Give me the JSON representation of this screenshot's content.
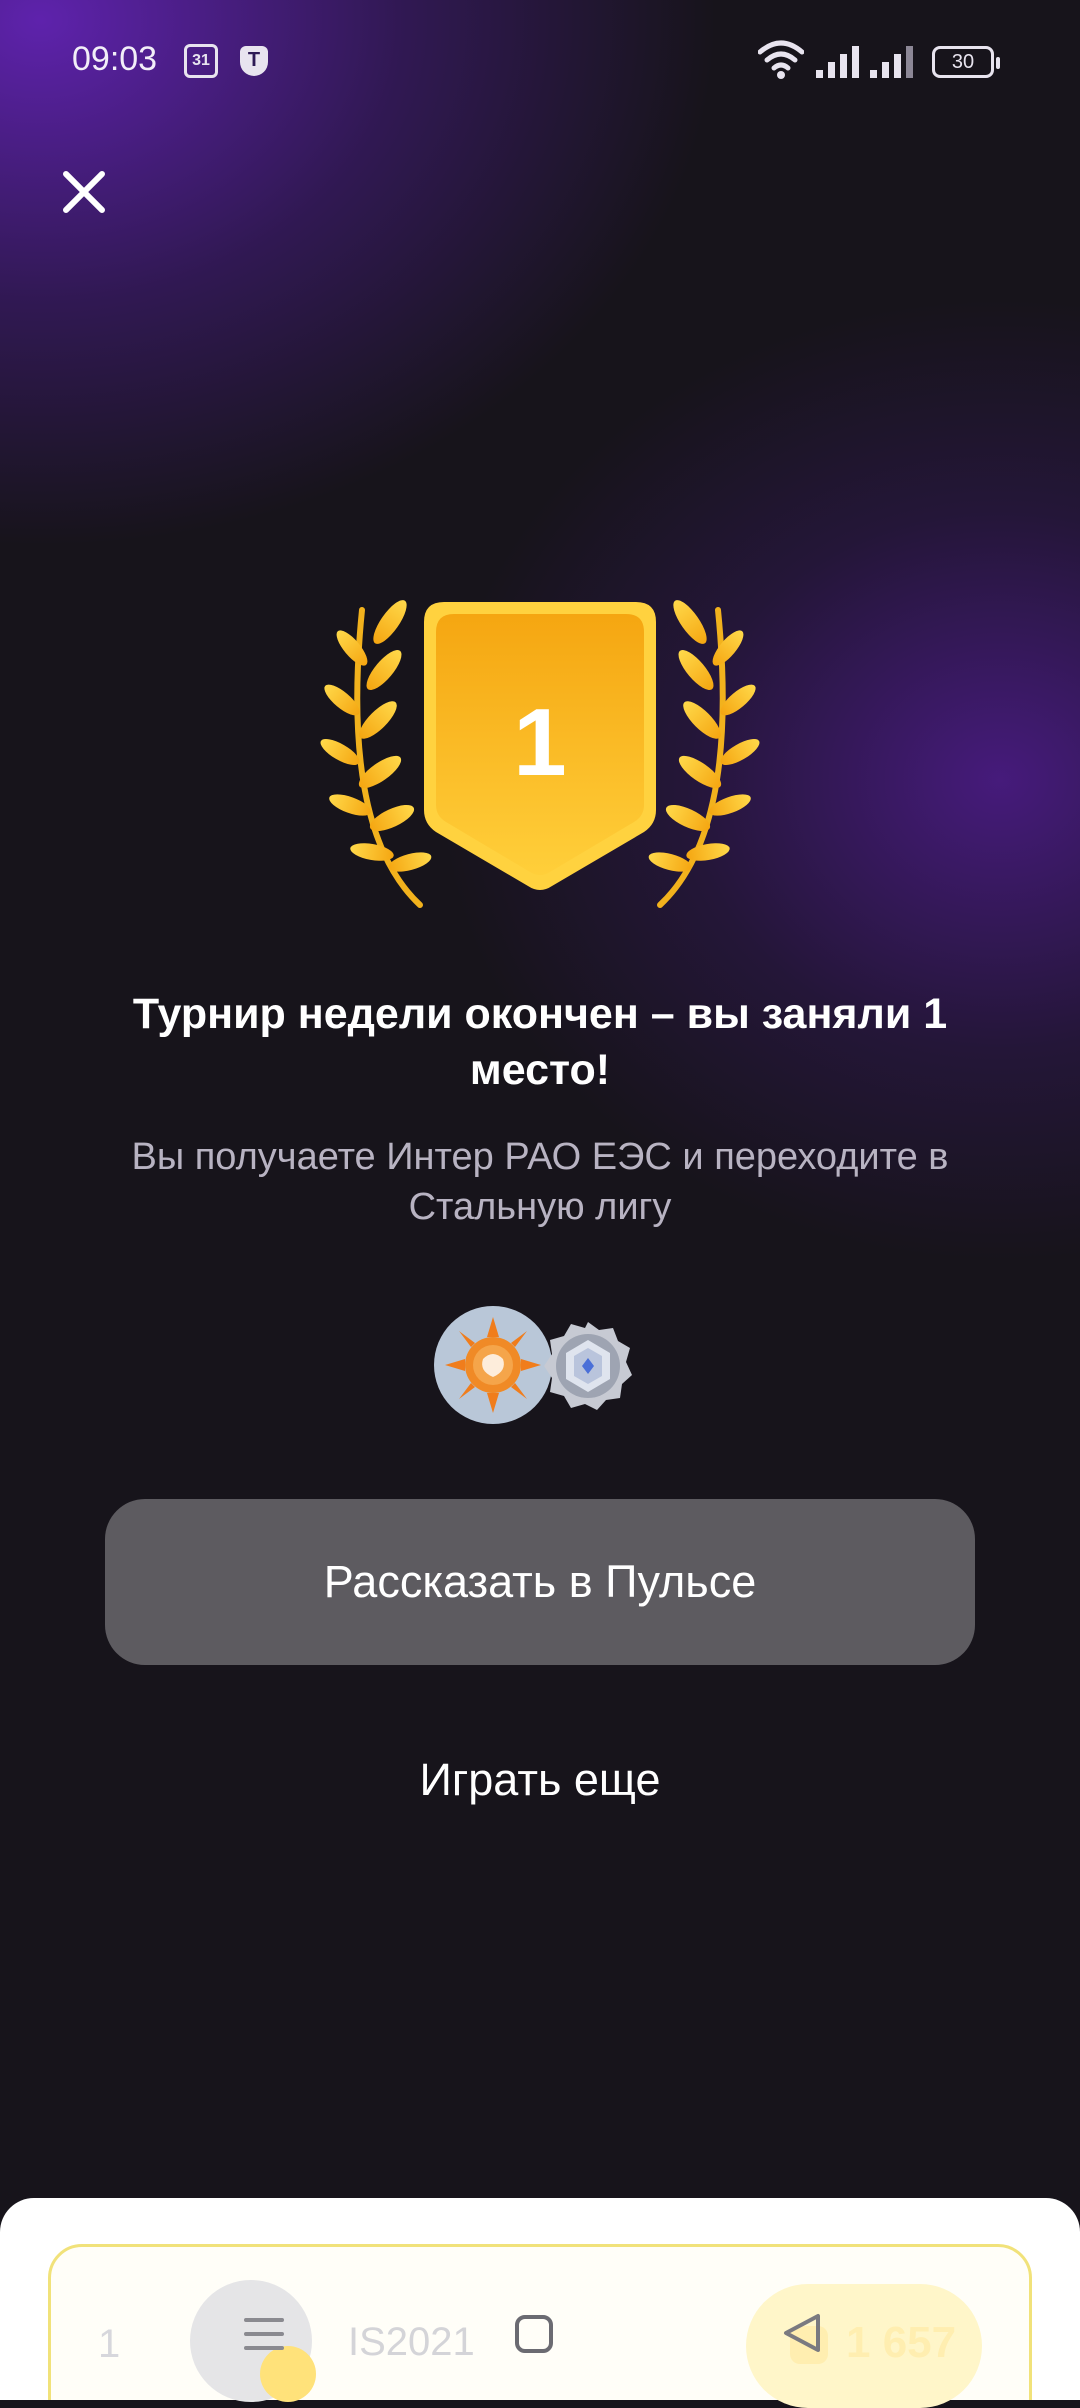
{
  "status_bar": {
    "time": "09:03",
    "calendar_day": "31",
    "notification_letter": "T",
    "battery_level": "30"
  },
  "award": {
    "place": "1",
    "headline": "Турнир недели окончен – вы заняли 1 место!",
    "subline": "Вы получаете Интер РАО ЕЭС и переходите в Стальную лигу"
  },
  "actions": {
    "share_label": "Рассказать в Пульсе",
    "play_again_label": "Играть еще"
  },
  "leaderboard_row": {
    "rank": "1",
    "name": "IS2021",
    "score": "1 657"
  },
  "colors": {
    "accent_gold": "#ffc21a",
    "gold_dark": "#f5a611",
    "background_dark": "#17141b",
    "background_purple": "#4d1a94",
    "button_gray": "#5d5b60"
  },
  "icons": {
    "close": "close-icon",
    "laurel": "laurel-wreath-icon",
    "trophy_badge": "first-place-shield-icon",
    "company": "inter-rao-logo",
    "league": "steel-league-badge-icon",
    "nav_menu": "menu-icon",
    "nav_home": "home-square-icon",
    "nav_back": "back-triangle-icon"
  }
}
